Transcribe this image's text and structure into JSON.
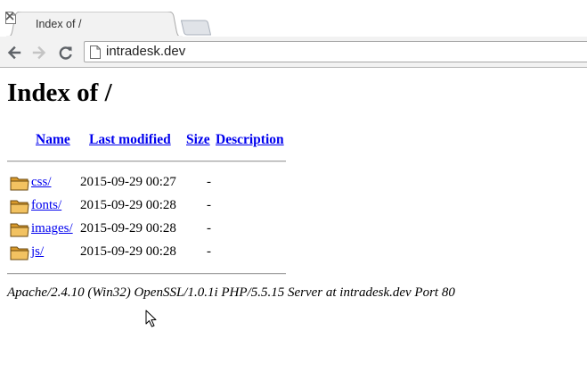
{
  "browser": {
    "tab": {
      "title": "Index of /"
    },
    "address_bar": {
      "url": "intradesk.dev"
    },
    "icons": {
      "favicon": "page-icon",
      "tab_close": "close-icon",
      "back": "back-arrow-icon",
      "forward": "forward-arrow-icon",
      "reload": "reload-icon",
      "omnibox_page": "page-icon"
    },
    "colors": {
      "chrome_bg": "#f2f2f2",
      "link": "#0000ee"
    }
  },
  "page": {
    "title": "Index of /",
    "columns": {
      "name": "Name",
      "last_modified": "Last modified",
      "size": "Size",
      "description": "Description"
    },
    "rows": [
      {
        "icon": "folder-icon",
        "name": "css/",
        "last_modified": "2015-09-29 00:27",
        "size": "-"
      },
      {
        "icon": "folder-icon",
        "name": "fonts/",
        "last_modified": "2015-09-29 00:28",
        "size": "-"
      },
      {
        "icon": "folder-icon",
        "name": "images/",
        "last_modified": "2015-09-29 00:28",
        "size": "-"
      },
      {
        "icon": "folder-icon",
        "name": "js/",
        "last_modified": "2015-09-29 00:28",
        "size": "-"
      }
    ],
    "server_signature": "Apache/2.4.10 (Win32) OpenSSL/1.0.1i PHP/5.5.15 Server at intradesk.dev Port 80"
  }
}
